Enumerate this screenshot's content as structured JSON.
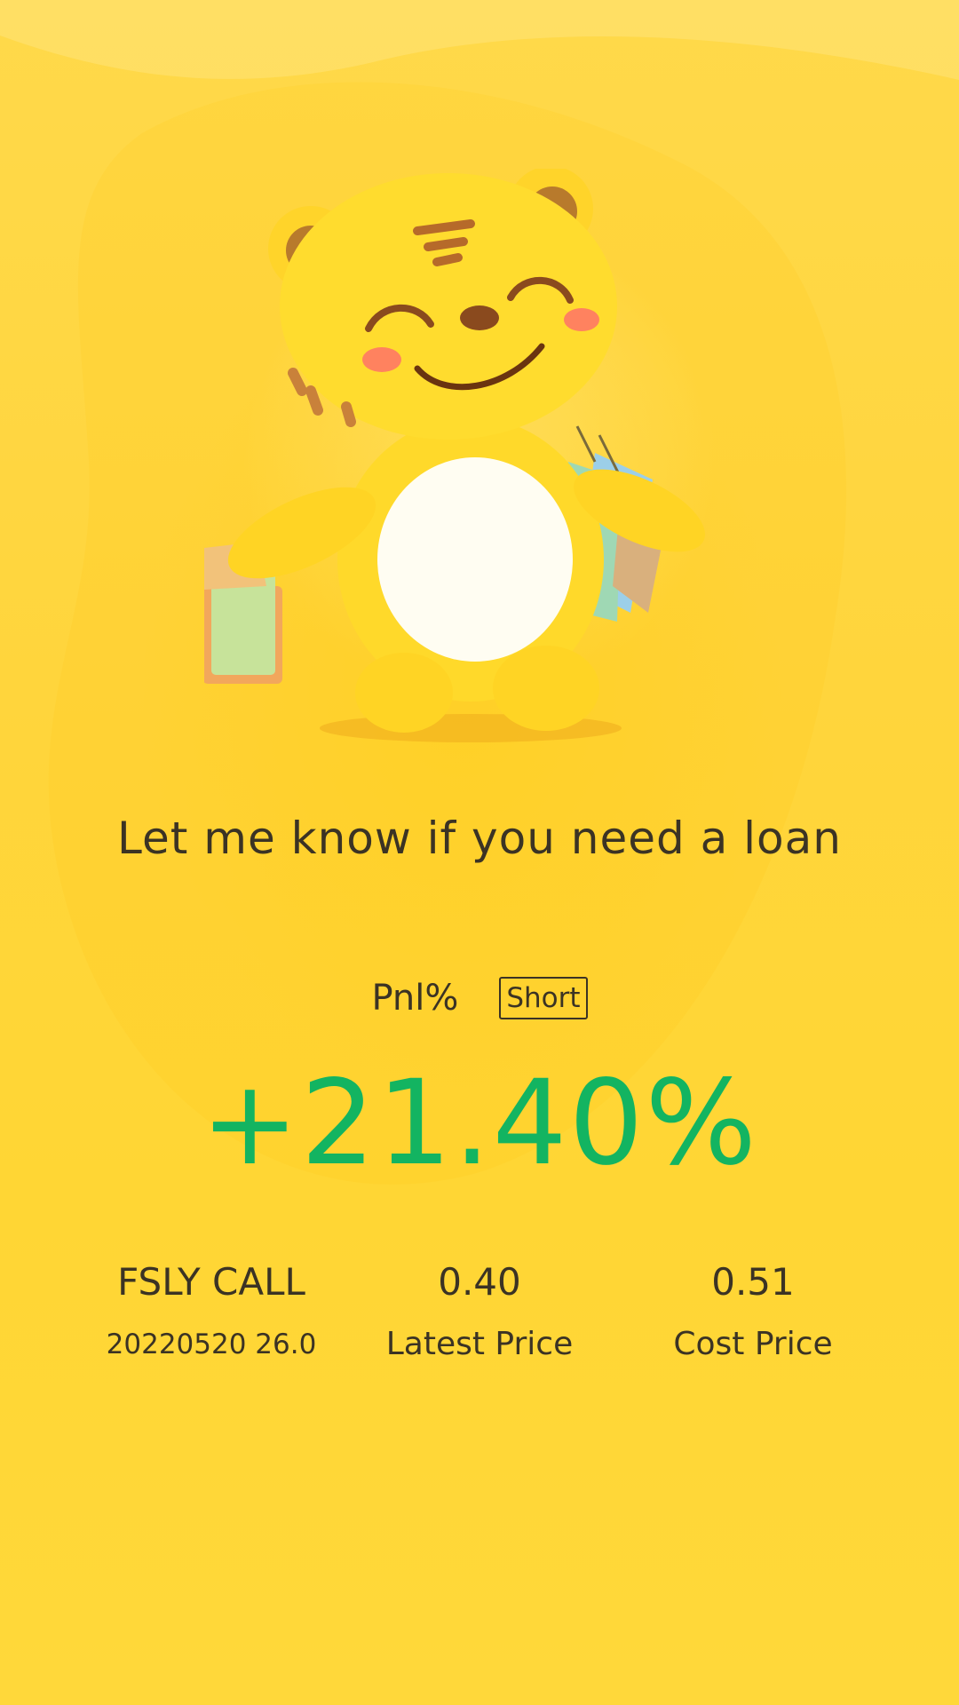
{
  "tagline": "Let me know if you need a loan",
  "pnl": {
    "label": "Pnl%",
    "direction": "Short",
    "value": "+21.40%"
  },
  "position": {
    "contract": "FSLY CALL",
    "detail": "20220520 26.0",
    "latest_price": "0.40",
    "latest_price_label": "Latest Price",
    "cost_price": "0.51",
    "cost_price_label": "Cost Price"
  },
  "colors": {
    "background": "#ffd63a",
    "text": "#3b3324",
    "gain": "#13b461"
  },
  "mascot": "tiger-mascot-with-shopping-bags"
}
